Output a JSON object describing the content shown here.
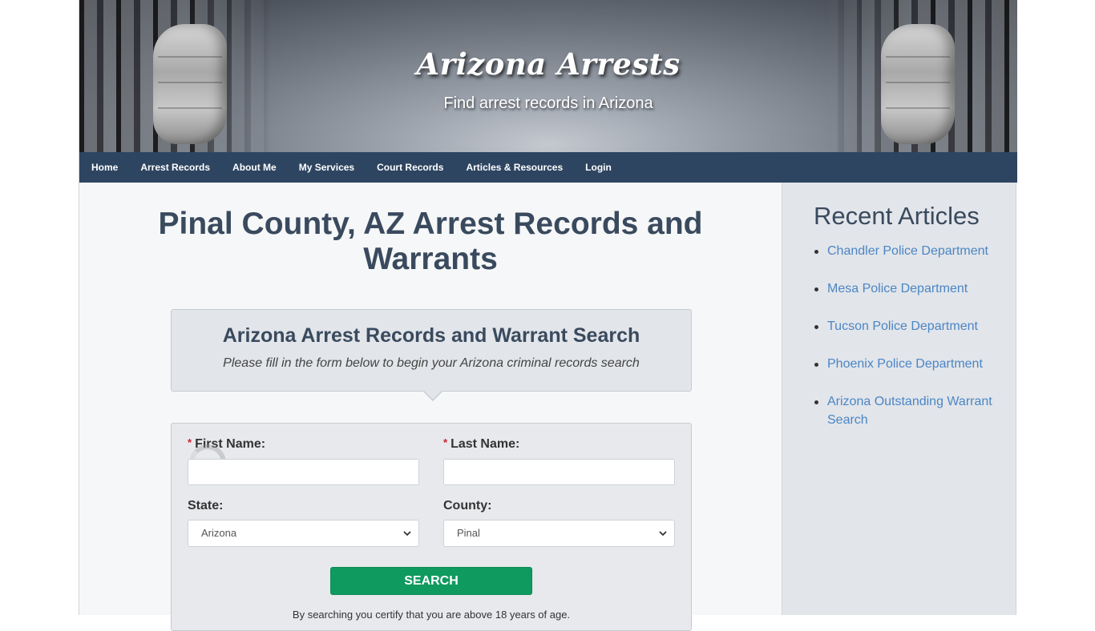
{
  "header": {
    "site_title": "Arizona Arrests",
    "tagline": "Find arrest records in Arizona"
  },
  "nav": {
    "items": [
      {
        "label": "Home"
      },
      {
        "label": "Arrest Records"
      },
      {
        "label": "About Me"
      },
      {
        "label": "My Services"
      },
      {
        "label": "Court Records"
      },
      {
        "label": "Articles & Resources"
      },
      {
        "label": "Login"
      }
    ]
  },
  "main": {
    "page_title": "Pinal County, AZ Arrest Records and Warrants",
    "search_box": {
      "title": "Arizona Arrest Records and Warrant Search",
      "subtitle": "Please fill in the form below to begin your Arizona criminal records search"
    },
    "form": {
      "required_marker": "*",
      "first_name_label": "First Name:",
      "first_name_value": "",
      "last_name_label": "Last Name:",
      "last_name_value": "",
      "state_label": "State:",
      "state_selected": "Arizona",
      "county_label": "County:",
      "county_selected": "Pinal",
      "search_button": "SEARCH",
      "disclaimer": "By searching you certify that you are above 18 years of age."
    }
  },
  "sidebar": {
    "heading": "Recent Articles",
    "articles": [
      {
        "label": "Chandler Police Department"
      },
      {
        "label": "Mesa Police Department"
      },
      {
        "label": "Tucson Police Department"
      },
      {
        "label": "Phoenix Police Department"
      },
      {
        "label": "Arizona Outstanding Warrant Search"
      }
    ]
  },
  "colors": {
    "nav_bg": "#2e4561",
    "heading": "#3a4a5e",
    "link": "#4b86c4",
    "search_button": "#0f9a5f",
    "required": "#d0202a"
  }
}
